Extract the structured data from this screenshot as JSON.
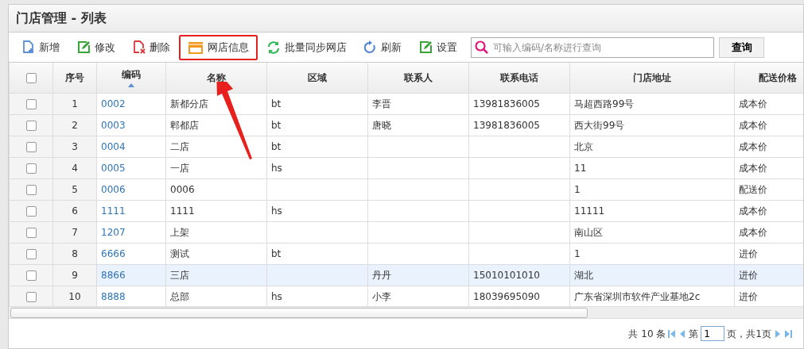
{
  "title": "门店管理 - 列表",
  "toolbar": [
    {
      "kind": "add",
      "label": "新增",
      "highlighted": false
    },
    {
      "kind": "edit",
      "label": "修改",
      "highlighted": false
    },
    {
      "kind": "delete",
      "label": "删除",
      "highlighted": false
    },
    {
      "kind": "shop",
      "label": "网店信息",
      "highlighted": true
    },
    {
      "kind": "sync",
      "label": "批量同步网店",
      "highlighted": false
    },
    {
      "kind": "refresh",
      "label": "刷新",
      "highlighted": false
    },
    {
      "kind": "settings",
      "label": "设置",
      "highlighted": false
    }
  ],
  "search": {
    "placeholder": "可输入编码/名称进行查询",
    "button": "查询"
  },
  "table": {
    "select_all": false,
    "columns": [
      {
        "label": "序号",
        "sorted": false
      },
      {
        "label": "编码",
        "sorted": true
      },
      {
        "label": "名称",
        "sorted": false
      },
      {
        "label": "区域",
        "sorted": false
      },
      {
        "label": "联系人",
        "sorted": false
      },
      {
        "label": "联系电话",
        "sorted": false
      },
      {
        "label": "门店地址",
        "sorted": false
      },
      {
        "label": "配送价格",
        "sorted": false
      }
    ],
    "rows": [
      {
        "selected": false,
        "checked": false,
        "cells": [
          "1",
          "0002",
          "新都分店",
          "bt",
          "李晋",
          "13981836005",
          "马超西路99号",
          "成本价"
        ]
      },
      {
        "selected": false,
        "checked": false,
        "cells": [
          "2",
          "0003",
          "郫都店",
          "bt",
          "唐晓",
          "13981836005",
          "西大街99号",
          "成本价"
        ]
      },
      {
        "selected": false,
        "checked": false,
        "cells": [
          "3",
          "0004",
          "二店",
          "bt",
          "",
          "",
          "北京",
          "成本价"
        ]
      },
      {
        "selected": false,
        "checked": false,
        "cells": [
          "4",
          "0005",
          "一店",
          "hs",
          "",
          "",
          "11",
          "成本价"
        ]
      },
      {
        "selected": false,
        "checked": false,
        "cells": [
          "5",
          "0006",
          "0006",
          "",
          "",
          "",
          "1",
          "配送价"
        ]
      },
      {
        "selected": false,
        "checked": false,
        "cells": [
          "6",
          "1111",
          "1111",
          "hs",
          "",
          "",
          "11111",
          "成本价"
        ]
      },
      {
        "selected": false,
        "checked": false,
        "cells": [
          "7",
          "1207",
          "上架",
          "",
          "",
          "",
          "南山区",
          "成本价"
        ]
      },
      {
        "selected": false,
        "checked": false,
        "cells": [
          "8",
          "6666",
          "测试",
          "bt",
          "",
          "",
          "1",
          "进价"
        ]
      },
      {
        "selected": true,
        "checked": false,
        "cells": [
          "9",
          "8866",
          "三店",
          "",
          "丹丹",
          "15010101010",
          "湖北",
          "进价"
        ]
      },
      {
        "selected": false,
        "checked": false,
        "cells": [
          "10",
          "8888",
          "总部",
          "hs",
          "小李",
          "18039695090",
          "广东省深圳市软件产业基地2c",
          "进价"
        ]
      }
    ]
  },
  "pager": {
    "total": "共 10 条",
    "page_prefix": "第",
    "page": "1",
    "page_suffix": "页，共1页"
  }
}
